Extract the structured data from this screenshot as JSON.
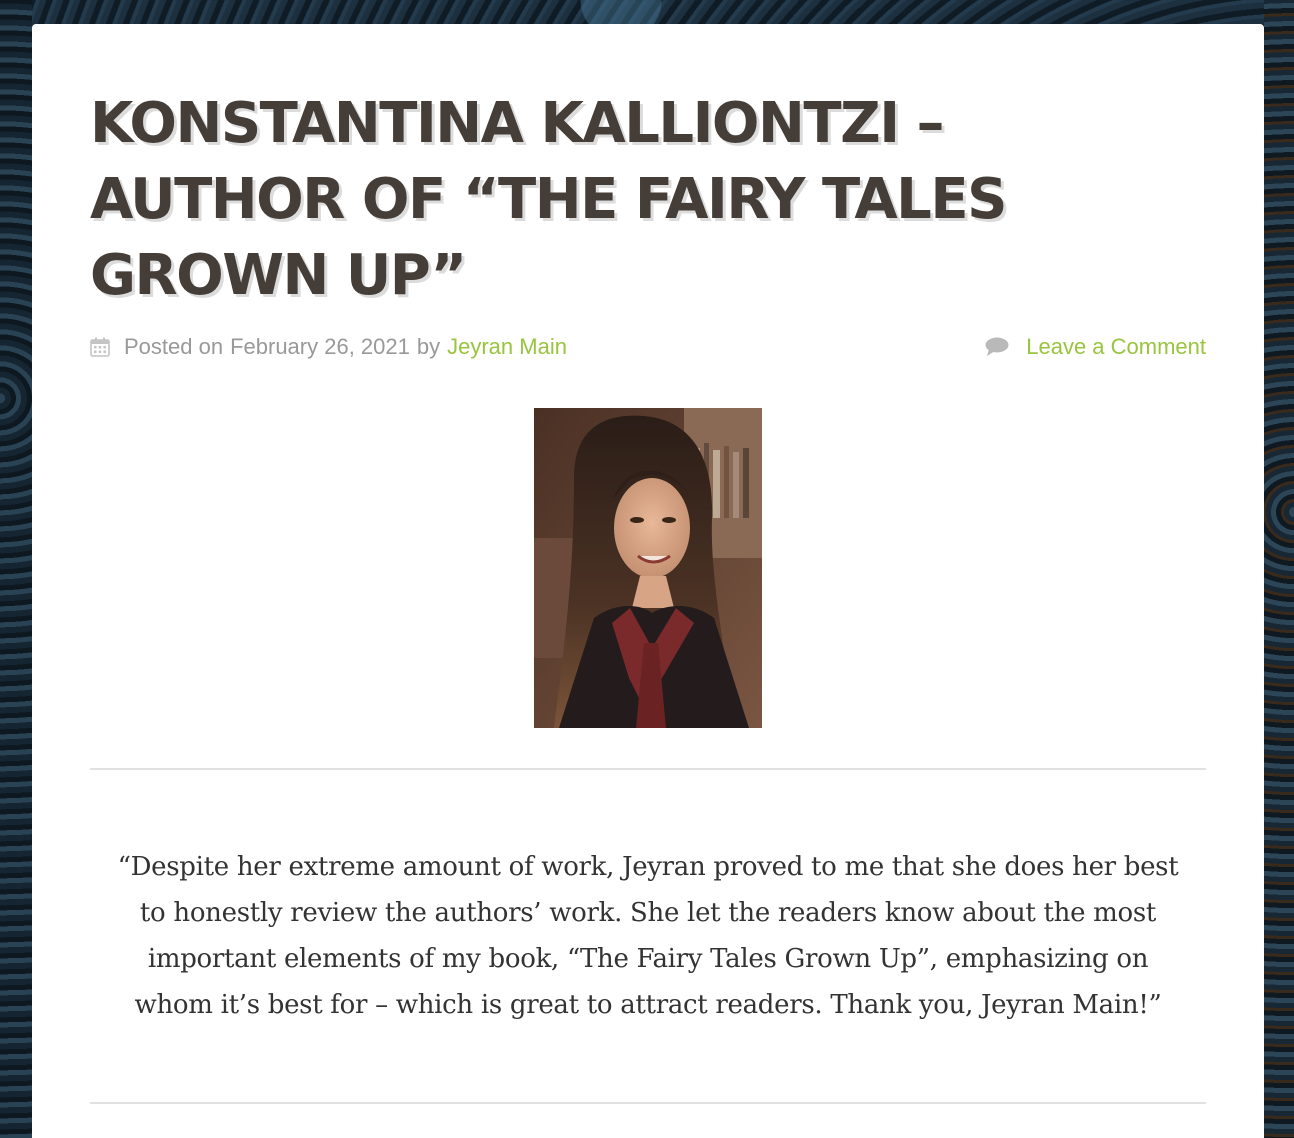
{
  "post": {
    "title": "KONSTANTINA KALLIONTZI – AUTHOR OF “THE FAIRY TALES GROWN UP”",
    "meta": {
      "posted_on_label": "Posted on",
      "date": "February 26, 2021",
      "by_label": "by",
      "author": "Jeyran Main",
      "comment_link": "Leave a Comment"
    },
    "quote": "“Despite her extreme amount of work, Jeyran proved to me that she does her best to honestly review the authors’ work. She let the readers know about the most important elements of my book, “The Fairy Tales Grown Up”, emphasizing on whom it’s best for – which is great to attract readers. Thank you, Jeyran Main!”"
  },
  "colors": {
    "title": "#443d38",
    "meta_text": "#999999",
    "link": "#99c43d",
    "divider": "#e1e1e1",
    "body_text": "#333333",
    "background_dark": "#132430"
  },
  "icons": {
    "date": "calendar-icon",
    "comments": "comment-bubble-icon"
  }
}
